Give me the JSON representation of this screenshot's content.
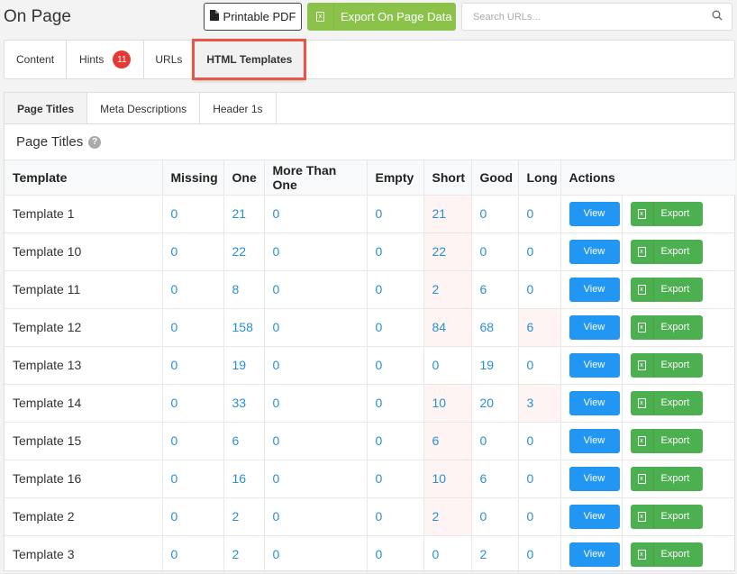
{
  "header": {
    "title": "On Page",
    "printable_pdf_label": "Printable PDF",
    "export_label": "Export On Page Data",
    "search_placeholder": "Search URLs..."
  },
  "main_tabs": [
    {
      "label": "Content",
      "active": false
    },
    {
      "label": "Hints",
      "badge": "11",
      "active": false
    },
    {
      "label": "URLs",
      "active": false
    },
    {
      "label": "HTML Templates",
      "active": true
    }
  ],
  "sub_tabs": [
    {
      "label": "Page Titles",
      "active": true
    },
    {
      "label": "Meta Descriptions",
      "active": false
    },
    {
      "label": "Header 1s",
      "active": false
    }
  ],
  "panel": {
    "title": "Page Titles",
    "help_icon": "question-circle-icon"
  },
  "table": {
    "columns": [
      "Template",
      "Missing",
      "One",
      "More Than One",
      "Empty",
      "Short",
      "Good",
      "Long",
      "Actions"
    ],
    "view_label": "View",
    "export_label": "Export",
    "rows": [
      {
        "template": "Template 1",
        "missing": "0",
        "one": "21",
        "more_than_one": "0",
        "empty": "0",
        "short": "21",
        "good": "0",
        "long": "0"
      },
      {
        "template": "Template 10",
        "missing": "0",
        "one": "22",
        "more_than_one": "0",
        "empty": "0",
        "short": "22",
        "good": "0",
        "long": "0"
      },
      {
        "template": "Template 11",
        "missing": "0",
        "one": "8",
        "more_than_one": "0",
        "empty": "0",
        "short": "2",
        "good": "6",
        "long": "0"
      },
      {
        "template": "Template 12",
        "missing": "0",
        "one": "158",
        "more_than_one": "0",
        "empty": "0",
        "short": "84",
        "good": "68",
        "long": "6"
      },
      {
        "template": "Template 13",
        "missing": "0",
        "one": "19",
        "more_than_one": "0",
        "empty": "0",
        "short": "0",
        "good": "19",
        "long": "0"
      },
      {
        "template": "Template 14",
        "missing": "0",
        "one": "33",
        "more_than_one": "0",
        "empty": "0",
        "short": "10",
        "good": "20",
        "long": "3"
      },
      {
        "template": "Template 15",
        "missing": "0",
        "one": "6",
        "more_than_one": "0",
        "empty": "0",
        "short": "6",
        "good": "0",
        "long": "0"
      },
      {
        "template": "Template 16",
        "missing": "0",
        "one": "16",
        "more_than_one": "0",
        "empty": "0",
        "short": "10",
        "good": "6",
        "long": "0"
      },
      {
        "template": "Template 2",
        "missing": "0",
        "one": "2",
        "more_than_one": "0",
        "empty": "0",
        "short": "2",
        "good": "0",
        "long": "0"
      },
      {
        "template": "Template 3",
        "missing": "0",
        "one": "2",
        "more_than_one": "0",
        "empty": "0",
        "short": "0",
        "good": "2",
        "long": "0"
      }
    ]
  },
  "colors": {
    "accent_blue": "#2196f3",
    "export_green": "#4caf50",
    "header_export_green": "#8bc34a",
    "badge_red": "#e53935",
    "highlight_outline": "#e8554a",
    "link_blue": "#2a8fd6",
    "warn_cell_bg": "#fdf4f3"
  }
}
